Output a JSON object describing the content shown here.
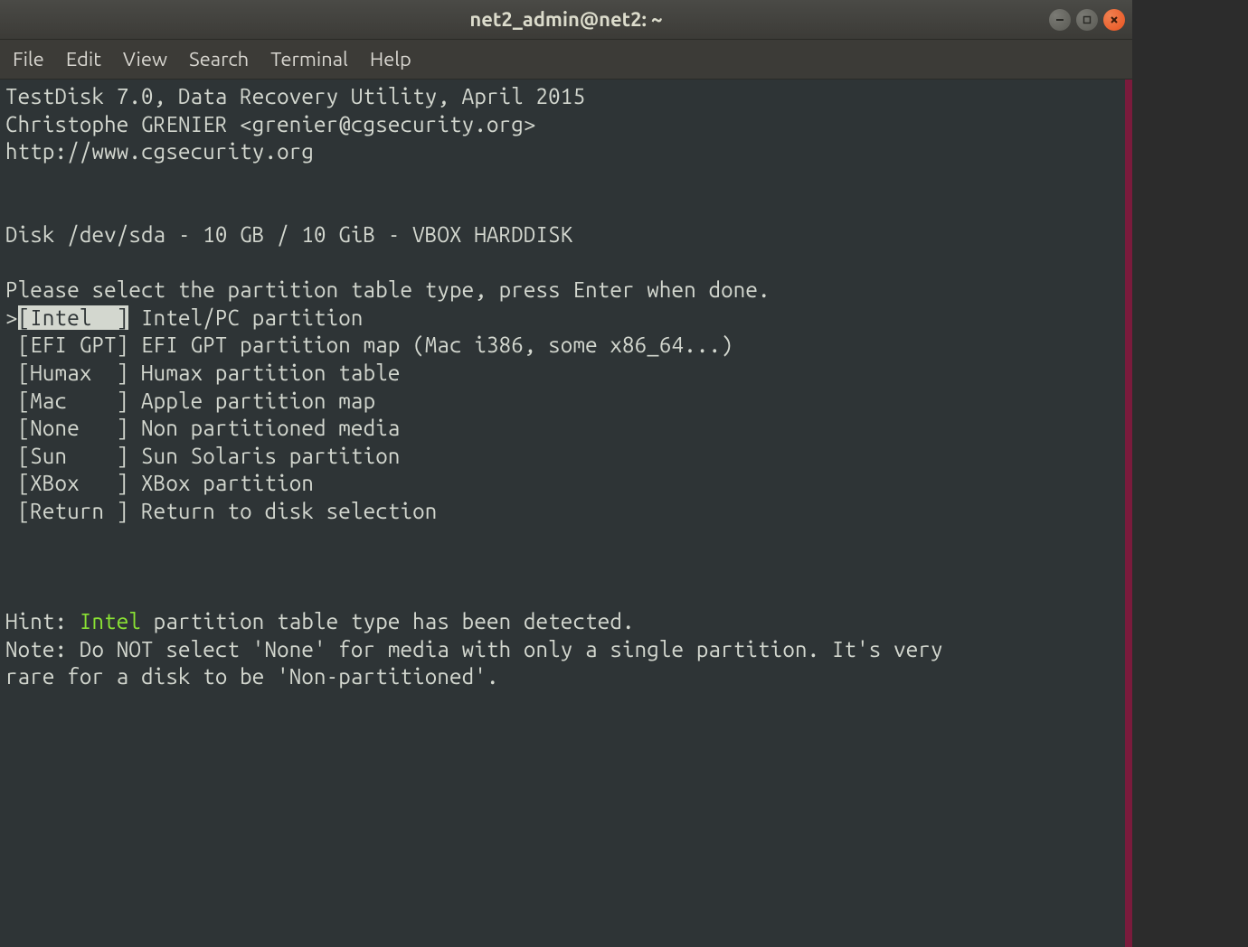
{
  "window": {
    "title": "net2_admin@net2: ~"
  },
  "menubar": {
    "items": [
      "File",
      "Edit",
      "View",
      "Search",
      "Terminal",
      "Help"
    ]
  },
  "header": {
    "line1": "TestDisk 7.0, Data Recovery Utility, April 2015",
    "line2": "Christophe GRENIER <grenier@cgsecurity.org>",
    "line3": "http://www.cgsecurity.org"
  },
  "disk_info": "Disk /dev/sda - 10 GB / 10 GiB - VBOX HARDDISK",
  "prompt": "Please select the partition table type, press Enter when done.",
  "options": [
    {
      "marker": ">",
      "label": "[Intel  ]",
      "desc": " Intel/PC partition",
      "selected": true
    },
    {
      "marker": " ",
      "label": "[EFI GPT]",
      "desc": " EFI GPT partition map (Mac i386, some x86_64...)",
      "selected": false
    },
    {
      "marker": " ",
      "label": "[Humax  ]",
      "desc": " Humax partition table",
      "selected": false
    },
    {
      "marker": " ",
      "label": "[Mac    ]",
      "desc": " Apple partition map",
      "selected": false
    },
    {
      "marker": " ",
      "label": "[None   ]",
      "desc": " Non partitioned media",
      "selected": false
    },
    {
      "marker": " ",
      "label": "[Sun    ]",
      "desc": " Sun Solaris partition",
      "selected": false
    },
    {
      "marker": " ",
      "label": "[XBox   ]",
      "desc": " XBox partition",
      "selected": false
    },
    {
      "marker": " ",
      "label": "[Return ]",
      "desc": " Return to disk selection",
      "selected": false
    }
  ],
  "hint": {
    "prefix": "Hint: ",
    "detected": "Intel",
    "suffix": " partition table type has been detected."
  },
  "note": "Note: Do NOT select 'None' for media with only a single partition. It's very\nrare for a disk to be 'Non-partitioned'."
}
